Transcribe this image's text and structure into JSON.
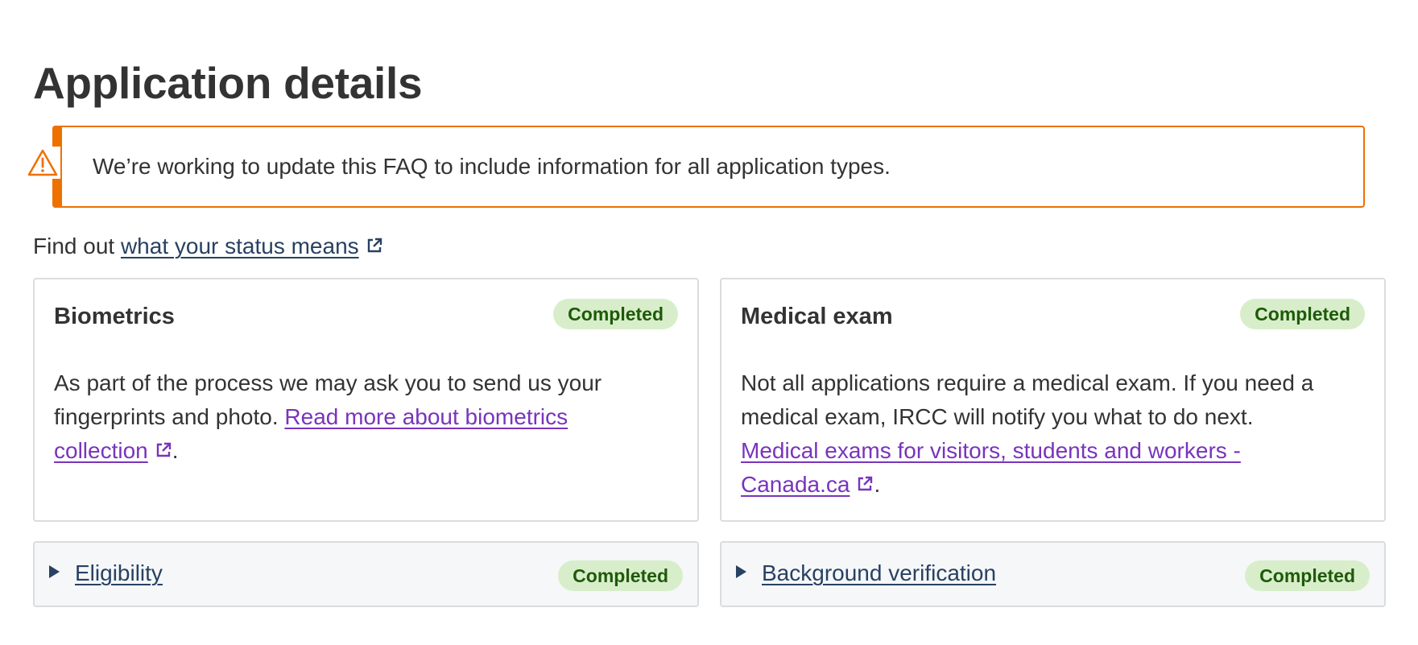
{
  "page": {
    "title": "Application details"
  },
  "alert": {
    "icon": "warning-triangle-icon",
    "text": "We’re working to update this FAQ to include information for all application types.",
    "color": "#ee7100"
  },
  "find_out": {
    "prefix": "Find out ",
    "link_text": "what your status means"
  },
  "cards": [
    {
      "title": "Biometrics",
      "status": "Completed",
      "body_text": "As part of the process we may ask you to send us your fingerprints and photo. ",
      "link_text": "Read more about biometrics collection",
      "suffix": "."
    },
    {
      "title": "Medical exam",
      "status": "Completed",
      "body_text": "Not all applications require a medical exam. If you need a medical exam, IRCC will notify you what to do next. ",
      "link_text": "Medical exams for visitors, students and workers - Canada.ca",
      "suffix": "."
    }
  ],
  "accordions": [
    {
      "label": "Eligibility",
      "status": "Completed"
    },
    {
      "label": "Background verification",
      "status": "Completed"
    }
  ],
  "colors": {
    "link": "#284162",
    "visited_link": "#7834bc",
    "badge_bg": "#d8eeca",
    "badge_text": "#1e5a0a",
    "warning": "#ee7100"
  }
}
